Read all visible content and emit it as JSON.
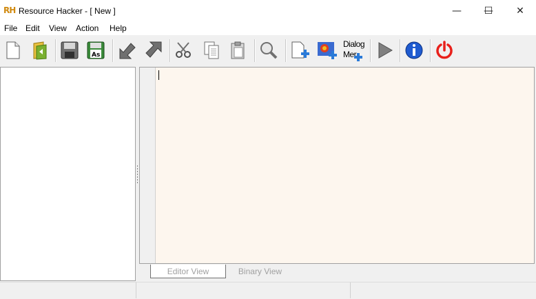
{
  "window": {
    "app_icon_text": "RH",
    "title": "Resource Hacker - [ New ]",
    "controls": {
      "minimize": "—",
      "maximize": "☐",
      "close": "✕"
    }
  },
  "menu": {
    "items": [
      "File",
      "Edit",
      "View",
      "Action",
      "Help"
    ]
  },
  "toolbar": {
    "dialog_menu_label_line1": "Dialog",
    "dialog_menu_label_line2": "Mer"
  },
  "tabs": {
    "editor_view": "Editor View",
    "binary_view": "Binary View"
  },
  "colors": {
    "editor_bg": "#fdf6ee",
    "accent_red": "#e8201b",
    "info_blue": "#1f5bd0",
    "folder_green": "#7ab030"
  }
}
